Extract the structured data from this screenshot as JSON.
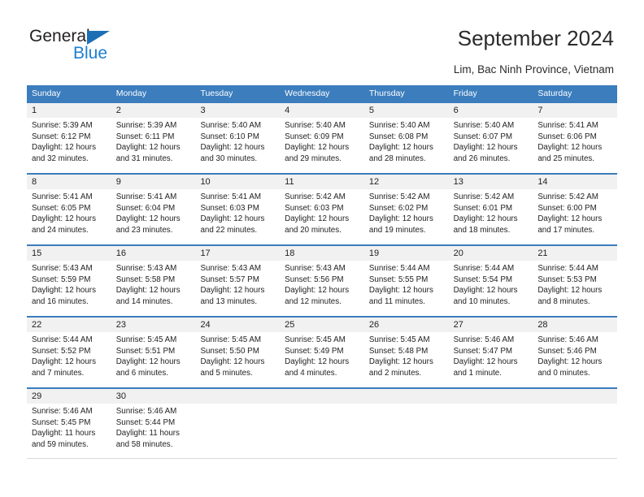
{
  "brand": {
    "name_top": "General",
    "name_bottom": "Blue",
    "triangle_color": "#1c6fb5",
    "blue_text_color": "#1c7fd0"
  },
  "header": {
    "title": "September 2024",
    "subtitle": "Lim, Bac Ninh Province, Vietnam",
    "header_bg": "#3b7dbd",
    "header_text": "#ffffff"
  },
  "weekdays": [
    "Sunday",
    "Monday",
    "Tuesday",
    "Wednesday",
    "Thursday",
    "Friday",
    "Saturday"
  ],
  "weeks": [
    [
      {
        "day": "1",
        "sunrise": "Sunrise: 5:39 AM",
        "sunset": "Sunset: 6:12 PM",
        "daylight1": "Daylight: 12 hours",
        "daylight2": "and 32 minutes."
      },
      {
        "day": "2",
        "sunrise": "Sunrise: 5:39 AM",
        "sunset": "Sunset: 6:11 PM",
        "daylight1": "Daylight: 12 hours",
        "daylight2": "and 31 minutes."
      },
      {
        "day": "3",
        "sunrise": "Sunrise: 5:40 AM",
        "sunset": "Sunset: 6:10 PM",
        "daylight1": "Daylight: 12 hours",
        "daylight2": "and 30 minutes."
      },
      {
        "day": "4",
        "sunrise": "Sunrise: 5:40 AM",
        "sunset": "Sunset: 6:09 PM",
        "daylight1": "Daylight: 12 hours",
        "daylight2": "and 29 minutes."
      },
      {
        "day": "5",
        "sunrise": "Sunrise: 5:40 AM",
        "sunset": "Sunset: 6:08 PM",
        "daylight1": "Daylight: 12 hours",
        "daylight2": "and 28 minutes."
      },
      {
        "day": "6",
        "sunrise": "Sunrise: 5:40 AM",
        "sunset": "Sunset: 6:07 PM",
        "daylight1": "Daylight: 12 hours",
        "daylight2": "and 26 minutes."
      },
      {
        "day": "7",
        "sunrise": "Sunrise: 5:41 AM",
        "sunset": "Sunset: 6:06 PM",
        "daylight1": "Daylight: 12 hours",
        "daylight2": "and 25 minutes."
      }
    ],
    [
      {
        "day": "8",
        "sunrise": "Sunrise: 5:41 AM",
        "sunset": "Sunset: 6:05 PM",
        "daylight1": "Daylight: 12 hours",
        "daylight2": "and 24 minutes."
      },
      {
        "day": "9",
        "sunrise": "Sunrise: 5:41 AM",
        "sunset": "Sunset: 6:04 PM",
        "daylight1": "Daylight: 12 hours",
        "daylight2": "and 23 minutes."
      },
      {
        "day": "10",
        "sunrise": "Sunrise: 5:41 AM",
        "sunset": "Sunset: 6:03 PM",
        "daylight1": "Daylight: 12 hours",
        "daylight2": "and 22 minutes."
      },
      {
        "day": "11",
        "sunrise": "Sunrise: 5:42 AM",
        "sunset": "Sunset: 6:03 PM",
        "daylight1": "Daylight: 12 hours",
        "daylight2": "and 20 minutes."
      },
      {
        "day": "12",
        "sunrise": "Sunrise: 5:42 AM",
        "sunset": "Sunset: 6:02 PM",
        "daylight1": "Daylight: 12 hours",
        "daylight2": "and 19 minutes."
      },
      {
        "day": "13",
        "sunrise": "Sunrise: 5:42 AM",
        "sunset": "Sunset: 6:01 PM",
        "daylight1": "Daylight: 12 hours",
        "daylight2": "and 18 minutes."
      },
      {
        "day": "14",
        "sunrise": "Sunrise: 5:42 AM",
        "sunset": "Sunset: 6:00 PM",
        "daylight1": "Daylight: 12 hours",
        "daylight2": "and 17 minutes."
      }
    ],
    [
      {
        "day": "15",
        "sunrise": "Sunrise: 5:43 AM",
        "sunset": "Sunset: 5:59 PM",
        "daylight1": "Daylight: 12 hours",
        "daylight2": "and 16 minutes."
      },
      {
        "day": "16",
        "sunrise": "Sunrise: 5:43 AM",
        "sunset": "Sunset: 5:58 PM",
        "daylight1": "Daylight: 12 hours",
        "daylight2": "and 14 minutes."
      },
      {
        "day": "17",
        "sunrise": "Sunrise: 5:43 AM",
        "sunset": "Sunset: 5:57 PM",
        "daylight1": "Daylight: 12 hours",
        "daylight2": "and 13 minutes."
      },
      {
        "day": "18",
        "sunrise": "Sunrise: 5:43 AM",
        "sunset": "Sunset: 5:56 PM",
        "daylight1": "Daylight: 12 hours",
        "daylight2": "and 12 minutes."
      },
      {
        "day": "19",
        "sunrise": "Sunrise: 5:44 AM",
        "sunset": "Sunset: 5:55 PM",
        "daylight1": "Daylight: 12 hours",
        "daylight2": "and 11 minutes."
      },
      {
        "day": "20",
        "sunrise": "Sunrise: 5:44 AM",
        "sunset": "Sunset: 5:54 PM",
        "daylight1": "Daylight: 12 hours",
        "daylight2": "and 10 minutes."
      },
      {
        "day": "21",
        "sunrise": "Sunrise: 5:44 AM",
        "sunset": "Sunset: 5:53 PM",
        "daylight1": "Daylight: 12 hours",
        "daylight2": "and 8 minutes."
      }
    ],
    [
      {
        "day": "22",
        "sunrise": "Sunrise: 5:44 AM",
        "sunset": "Sunset: 5:52 PM",
        "daylight1": "Daylight: 12 hours",
        "daylight2": "and 7 minutes."
      },
      {
        "day": "23",
        "sunrise": "Sunrise: 5:45 AM",
        "sunset": "Sunset: 5:51 PM",
        "daylight1": "Daylight: 12 hours",
        "daylight2": "and 6 minutes."
      },
      {
        "day": "24",
        "sunrise": "Sunrise: 5:45 AM",
        "sunset": "Sunset: 5:50 PM",
        "daylight1": "Daylight: 12 hours",
        "daylight2": "and 5 minutes."
      },
      {
        "day": "25",
        "sunrise": "Sunrise: 5:45 AM",
        "sunset": "Sunset: 5:49 PM",
        "daylight1": "Daylight: 12 hours",
        "daylight2": "and 4 minutes."
      },
      {
        "day": "26",
        "sunrise": "Sunrise: 5:45 AM",
        "sunset": "Sunset: 5:48 PM",
        "daylight1": "Daylight: 12 hours",
        "daylight2": "and 2 minutes."
      },
      {
        "day": "27",
        "sunrise": "Sunrise: 5:46 AM",
        "sunset": "Sunset: 5:47 PM",
        "daylight1": "Daylight: 12 hours",
        "daylight2": "and 1 minute."
      },
      {
        "day": "28",
        "sunrise": "Sunrise: 5:46 AM",
        "sunset": "Sunset: 5:46 PM",
        "daylight1": "Daylight: 12 hours",
        "daylight2": "and 0 minutes."
      }
    ],
    [
      {
        "day": "29",
        "sunrise": "Sunrise: 5:46 AM",
        "sunset": "Sunset: 5:45 PM",
        "daylight1": "Daylight: 11 hours",
        "daylight2": "and 59 minutes."
      },
      {
        "day": "30",
        "sunrise": "Sunrise: 5:46 AM",
        "sunset": "Sunset: 5:44 PM",
        "daylight1": "Daylight: 11 hours",
        "daylight2": "and 58 minutes."
      },
      {
        "day": "",
        "sunrise": "",
        "sunset": "",
        "daylight1": "",
        "daylight2": ""
      },
      {
        "day": "",
        "sunrise": "",
        "sunset": "",
        "daylight1": "",
        "daylight2": ""
      },
      {
        "day": "",
        "sunrise": "",
        "sunset": "",
        "daylight1": "",
        "daylight2": ""
      },
      {
        "day": "",
        "sunrise": "",
        "sunset": "",
        "daylight1": "",
        "daylight2": ""
      },
      {
        "day": "",
        "sunrise": "",
        "sunset": "",
        "daylight1": "",
        "daylight2": ""
      }
    ]
  ]
}
